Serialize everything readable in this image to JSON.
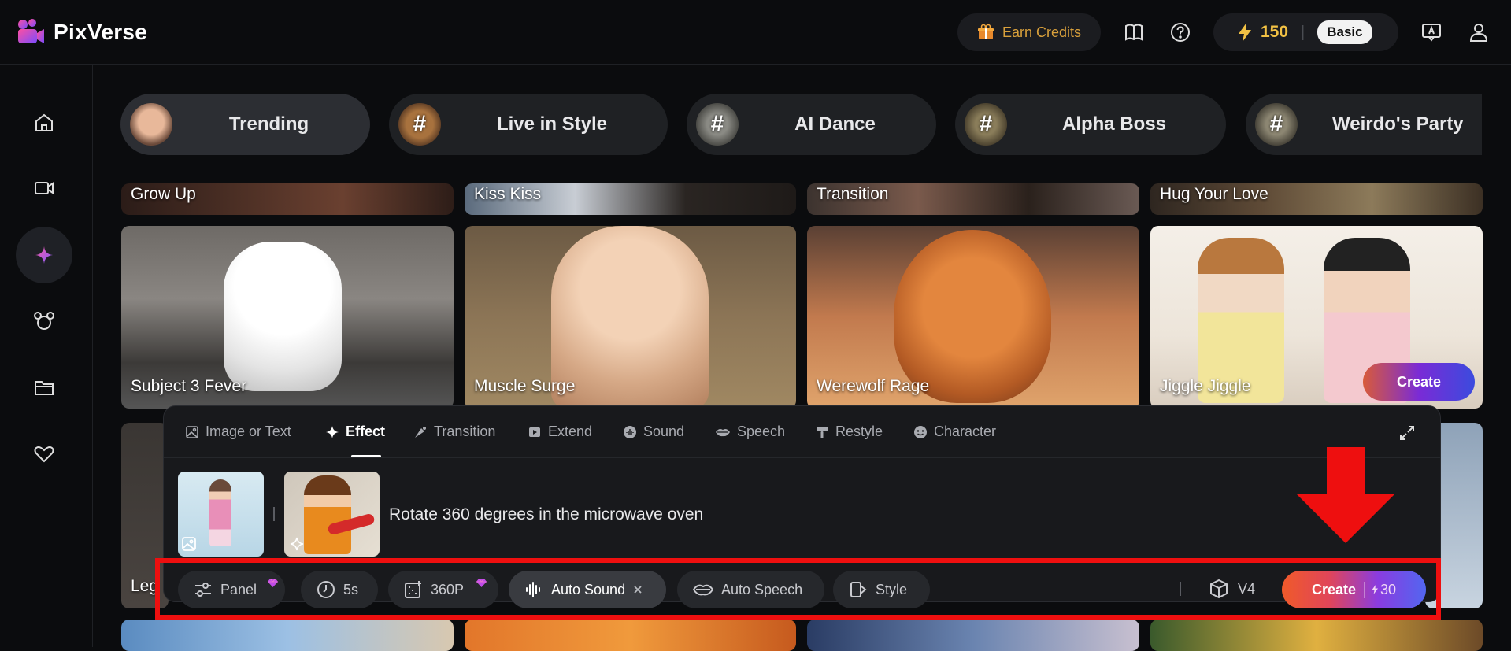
{
  "header": {
    "brand": "PixVerse",
    "earn_credits": "Earn Credits",
    "credits": "150",
    "plan": "Basic"
  },
  "sidebar": {
    "items": [
      {
        "icon": "home-icon"
      },
      {
        "icon": "video-icon"
      },
      {
        "icon": "sparkle-icon",
        "active": true
      },
      {
        "icon": "mouse-ears-icon"
      },
      {
        "icon": "folder-icon"
      },
      {
        "icon": "heart-icon"
      }
    ]
  },
  "trends": [
    {
      "label": "Trending",
      "hash": ""
    },
    {
      "label": "Live in Style",
      "hash": "#"
    },
    {
      "label": "AI Dance",
      "hash": "#"
    },
    {
      "label": "Alpha Boss",
      "hash": "#"
    },
    {
      "label": "Weirdo's Party",
      "hash": "#"
    }
  ],
  "cards_top_row": [
    "Grow Up",
    "Kiss Kiss",
    "Transition",
    "Hug Your Love"
  ],
  "cards_main_row": [
    "Subject 3 Fever",
    "Muscle Surge",
    "Werewolf Rage",
    "Jiggle Jiggle"
  ],
  "card_create": "Create",
  "partial_card": "Leg",
  "panel": {
    "tabs": [
      "Image or Text",
      "Effect",
      "Transition",
      "Extend",
      "Sound",
      "Speech",
      "Restyle",
      "Character"
    ],
    "prompt": "Rotate 360 degrees in the microwave oven",
    "toolbar": {
      "panel": "Panel",
      "duration": "5s",
      "resolution": "360P",
      "auto_sound": "Auto Sound",
      "auto_speech": "Auto Speech",
      "style": "Style",
      "model": "V4",
      "create": "Create",
      "cost": "30"
    }
  },
  "colors": {
    "accent_gold": "#f2c144",
    "annotation_red": "#ee0f0f"
  }
}
